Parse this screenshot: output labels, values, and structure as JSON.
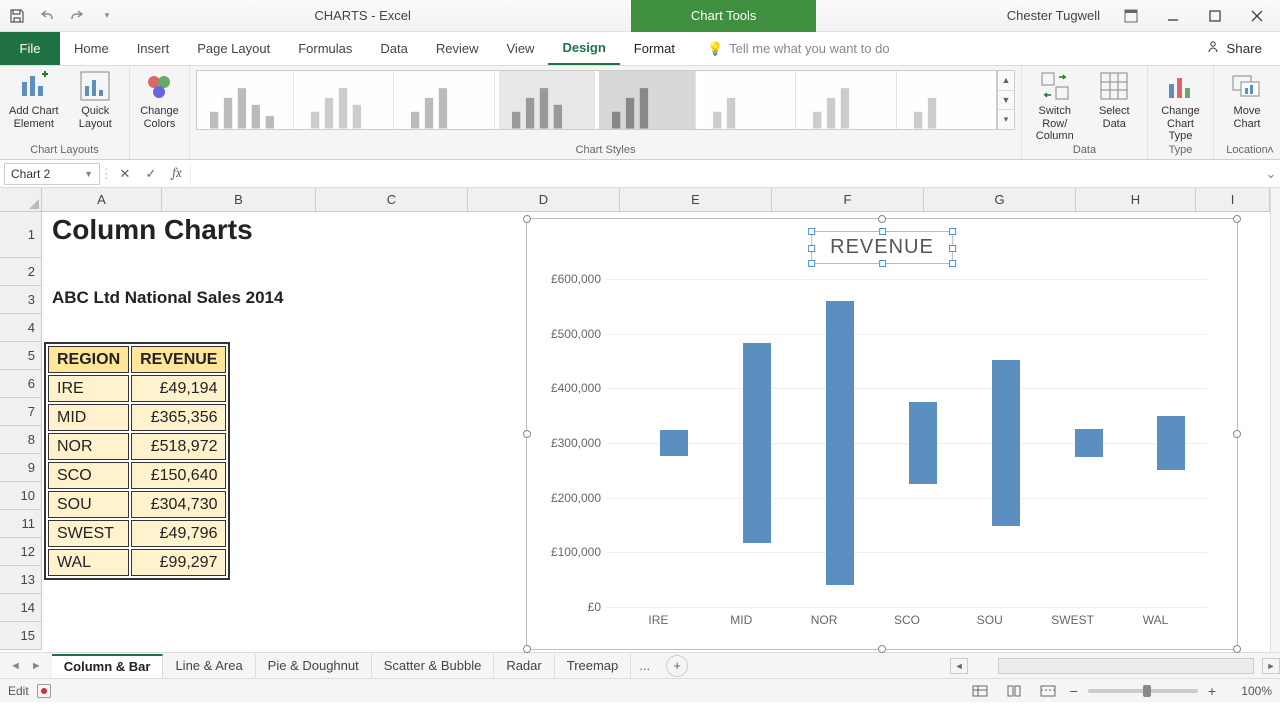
{
  "titlebar": {
    "document_title": "CHARTS - Excel",
    "context_tab": "Chart Tools",
    "user": "Chester Tugwell"
  },
  "ribbon_tabs": {
    "file": "File",
    "items": [
      "Home",
      "Insert",
      "Page Layout",
      "Formulas",
      "Data",
      "Review",
      "View",
      "Design",
      "Format"
    ],
    "active": "Design",
    "tell_me": "Tell me what you want to do",
    "share": "Share"
  },
  "ribbon": {
    "chart_layouts": {
      "add_element": "Add Chart Element",
      "quick_layout": "Quick Layout",
      "label": "Chart Layouts"
    },
    "chart_colors": {
      "change_colors": "Change Colors"
    },
    "chart_styles": {
      "label": "Chart Styles"
    },
    "data_group": {
      "switch": "Switch Row/ Column",
      "select_data": "Select Data",
      "label": "Data"
    },
    "type_group": {
      "change_type": "Change Chart Type",
      "label": "Type"
    },
    "location_group": {
      "move_chart": "Move Chart",
      "label": "Location"
    }
  },
  "namebox": "Chart 2",
  "formula_value": "",
  "columns": [
    {
      "l": "A",
      "w": 120
    },
    {
      "l": "B",
      "w": 154
    },
    {
      "l": "C",
      "w": 152
    },
    {
      "l": "D",
      "w": 152
    },
    {
      "l": "E",
      "w": 152
    },
    {
      "l": "F",
      "w": 152
    },
    {
      "l": "G",
      "w": 152
    },
    {
      "l": "H",
      "w": 120
    },
    {
      "l": "I",
      "w": 74
    }
  ],
  "rows": [
    "1",
    "2",
    "3",
    "4",
    "5",
    "6",
    "7",
    "8",
    "9",
    "10",
    "11",
    "12",
    "13",
    "14",
    "15"
  ],
  "sheet": {
    "title": "Column  Charts",
    "subtitle": "ABC Ltd National Sales 2014",
    "headers": {
      "region": "REGION",
      "revenue": "REVENUE"
    },
    "rows": [
      {
        "region": "IRE",
        "revenue": "£49,194"
      },
      {
        "region": "MID",
        "revenue": "£365,356"
      },
      {
        "region": "NOR",
        "revenue": "£518,972"
      },
      {
        "region": "SCO",
        "revenue": "£150,640"
      },
      {
        "region": "SOU",
        "revenue": "£304,730"
      },
      {
        "region": "SWEST",
        "revenue": "£49,796"
      },
      {
        "region": "WAL",
        "revenue": "£99,297"
      }
    ]
  },
  "chart_data": {
    "type": "bar",
    "title": "REVENUE",
    "categories": [
      "IRE",
      "MID",
      "NOR",
      "SCO",
      "SOU",
      "SWEST",
      "WAL"
    ],
    "values": [
      49194,
      365356,
      518972,
      150640,
      304730,
      49796,
      99297
    ],
    "ylim": [
      0,
      600000
    ],
    "yticks_labels": [
      "£0",
      "£100,000",
      "£200,000",
      "£300,000",
      "£400,000",
      "£500,000",
      "£600,000"
    ],
    "yticks_values": [
      0,
      100000,
      200000,
      300000,
      400000,
      500000,
      600000
    ],
    "bar_color": "#5a8fbf"
  },
  "sheet_tabs": {
    "items": [
      "Column & Bar",
      "Line & Area",
      "Pie & Doughnut",
      "Scatter & Bubble",
      "Radar",
      "Treemap"
    ],
    "overflow": "...",
    "active": "Column & Bar"
  },
  "status": {
    "mode": "Edit",
    "zoom": "100%"
  }
}
